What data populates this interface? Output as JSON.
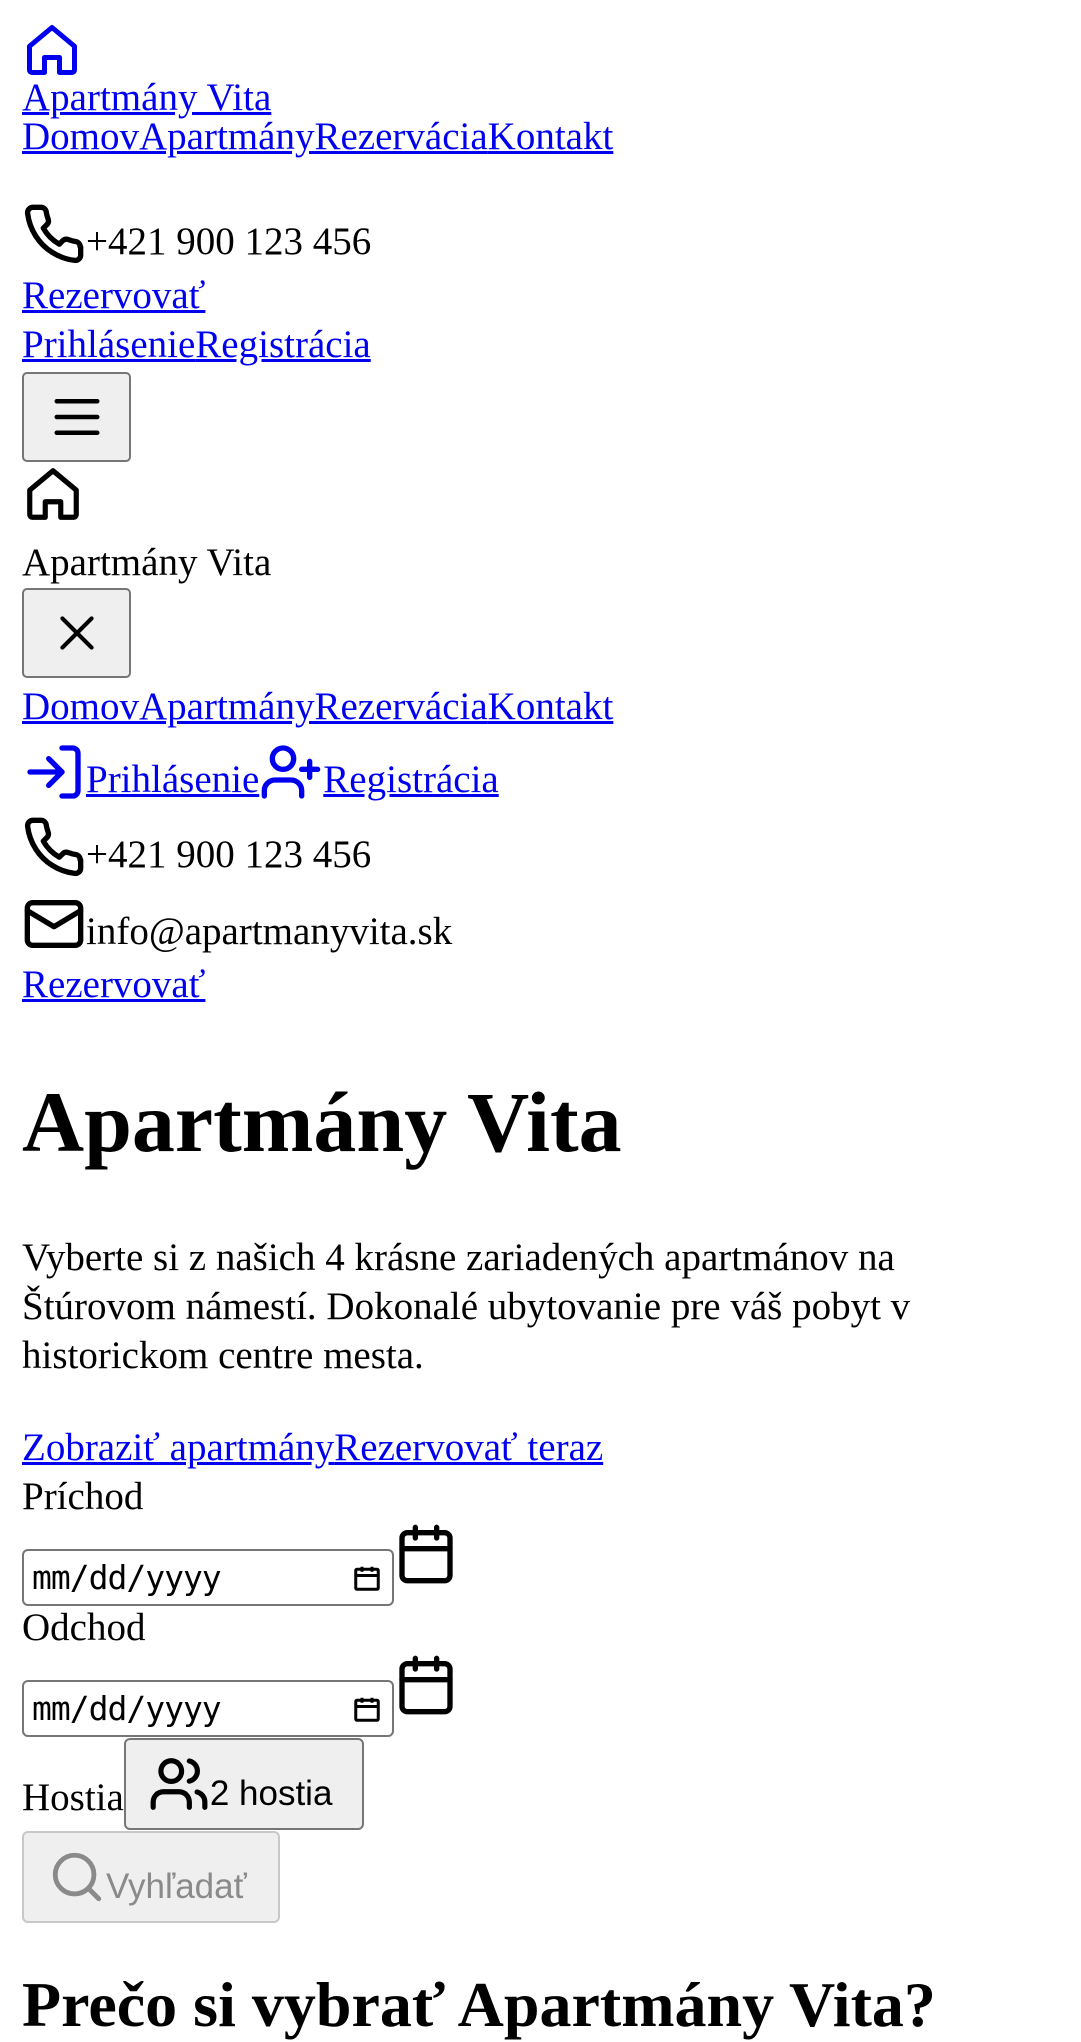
{
  "header": {
    "brand": "Apartmány Vita",
    "nav": [
      "Domov",
      "Apartmány",
      "Rezervácia",
      "Kontakt"
    ],
    "phone": "+421 900 123 456",
    "book": "Rezervovať",
    "login": "Prihlásenie",
    "register": "Registrácia"
  },
  "mobile_menu": {
    "brand": "Apartmány Vita",
    "nav": [
      "Domov",
      "Apartmány",
      "Rezervácia",
      "Kontakt"
    ],
    "login": "Prihlásenie",
    "register": "Registrácia",
    "phone": "+421 900 123 456",
    "email": "info@apartmanyvita.sk",
    "book": "Rezervovať"
  },
  "hero": {
    "title": "Apartmány Vita",
    "description": "Vyberte si z našich 4 krásne zariadených apartmánov na Štúrovom námestí. Dokonalé ubytovanie pre váš pobyt v historickom centre mesta.",
    "cta_apartments": "Zobraziť apartmány",
    "cta_book": "Rezervovať teraz"
  },
  "search": {
    "checkin_label": "Príchod",
    "checkin_value": "mm/dd/yyyy",
    "checkout_label": "Odchod",
    "checkout_value": "mm/dd/yyyy",
    "guests_label": "Hostia",
    "guests_value": "2 hostia",
    "submit": "Vyhľadať"
  },
  "section": {
    "title": "Prečo si vybrať Apartmány Vita?"
  },
  "icons": [
    "home-icon",
    "phone-icon",
    "menu-icon",
    "close-icon",
    "login-icon",
    "user-plus-icon",
    "mail-icon",
    "calendar-icon",
    "users-icon",
    "search-icon"
  ]
}
